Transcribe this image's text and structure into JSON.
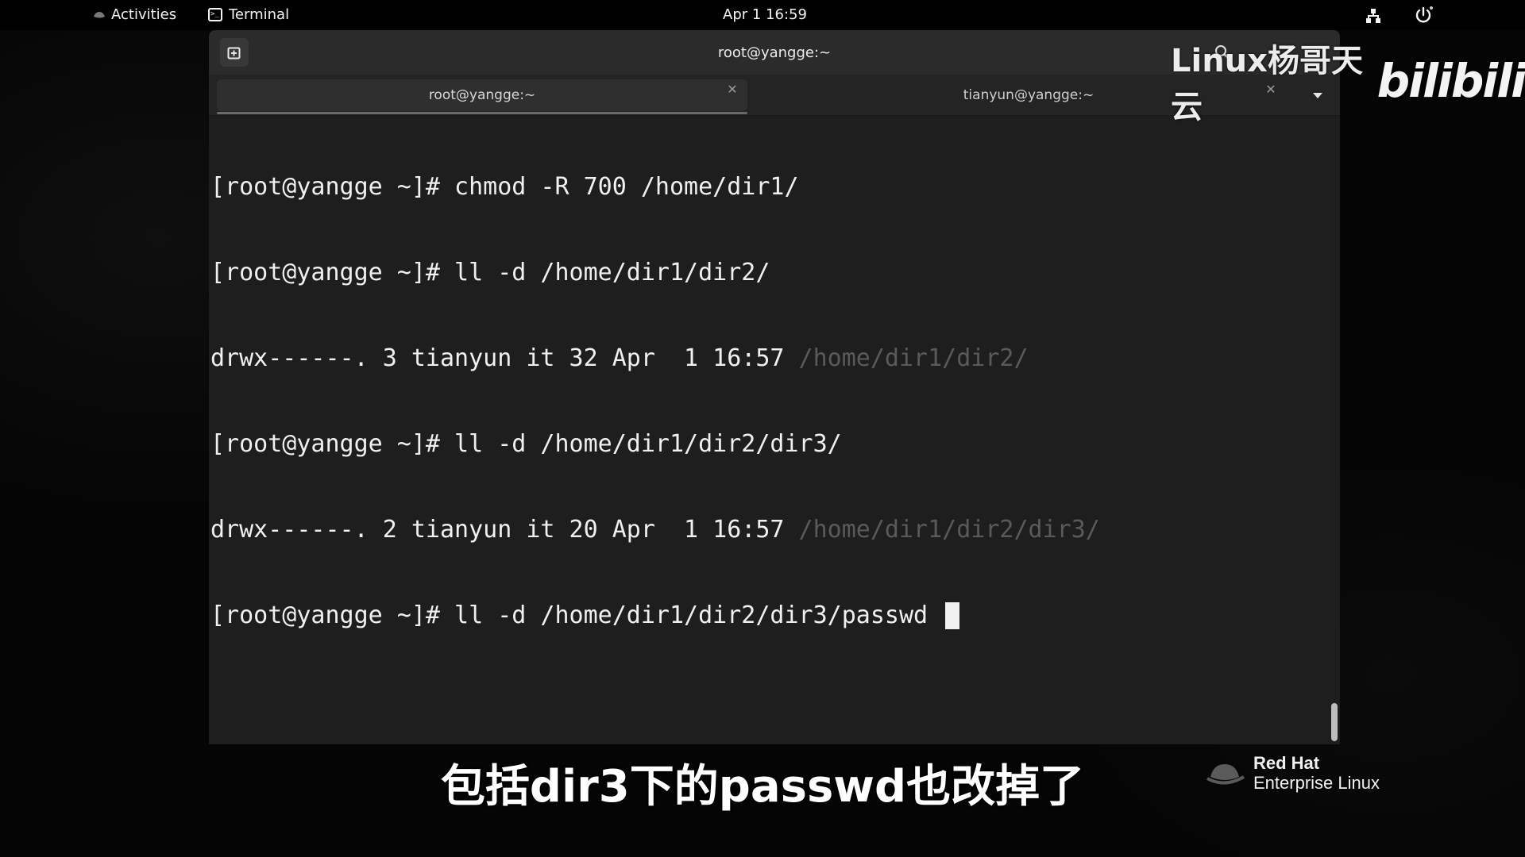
{
  "topbar": {
    "activities_label": "Activities",
    "app_label": "Terminal",
    "clock": "Apr 1  16:59"
  },
  "window": {
    "title": "root@yangge:~",
    "tabs": [
      {
        "label": "root@yangge:~",
        "active": true
      },
      {
        "label": "tianyun@yangge:~",
        "active": false
      }
    ]
  },
  "terminal": {
    "lines": [
      {
        "text": "[root@yangge ~]# chmod -R 700 /home/dir1/",
        "dim": ""
      },
      {
        "text": "[root@yangge ~]# ll -d /home/dir1/dir2/",
        "dim": ""
      },
      {
        "text": "drwx------. 3 tianyun it 32 Apr  1 16:57 ",
        "dim": "/home/dir1/dir2/"
      },
      {
        "text": "[root@yangge ~]# ll -d /home/dir1/dir2/dir3/",
        "dim": ""
      },
      {
        "text": "drwx------. 2 tianyun it 20 Apr  1 16:57 ",
        "dim": "/home/dir1/dir2/dir3/"
      },
      {
        "text": "[root@yangge ~]# ll -d /home/dir1/dir2/dir3/passwd ",
        "dim": ""
      }
    ]
  },
  "watermark": {
    "channel": "Linux杨哥天云",
    "site": "bilibili"
  },
  "subtitle": "包括dir3下的passwd也改掉了",
  "branding": {
    "line1": "Red Hat",
    "line2": "Enterprise Linux"
  },
  "colors": {
    "terminal_bg": "#1e1e1e",
    "headerbar_bg": "#2b2b2b",
    "dim_text": "#5a5a5a"
  },
  "icons": {
    "new_tab": "new-tab-icon",
    "search": "search-icon",
    "network": "network-icon",
    "power": "power-icon",
    "tab_menu": "chevron-down-icon"
  }
}
